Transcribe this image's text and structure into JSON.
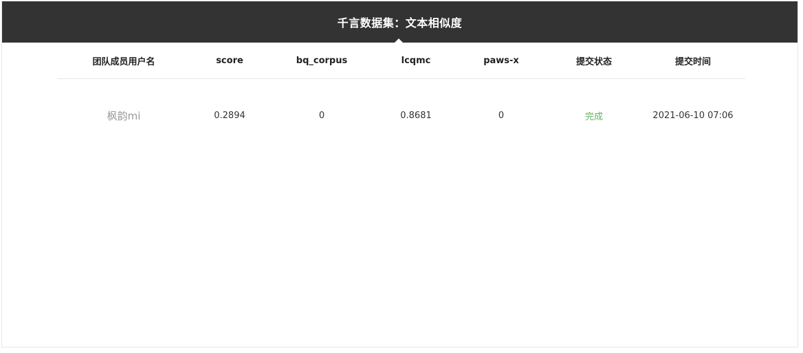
{
  "header": {
    "title": "千言数据集：文本相似度"
  },
  "table": {
    "columns": [
      "团队成员用户名",
      "score",
      "bq_corpus",
      "lcqmc",
      "paws-x",
      "提交状态",
      "提交时间"
    ],
    "rows": [
      {
        "username": "枫韵mi",
        "score": "0.2894",
        "bq_corpus": "0",
        "lcqmc": "0.8681",
        "paws_x": "0",
        "status": "完成",
        "submit_time": "2021-06-10 07:06"
      }
    ]
  },
  "colors": {
    "title_bar_bg": "#333333",
    "status_done": "#5fb35f",
    "username_text": "#999999"
  }
}
